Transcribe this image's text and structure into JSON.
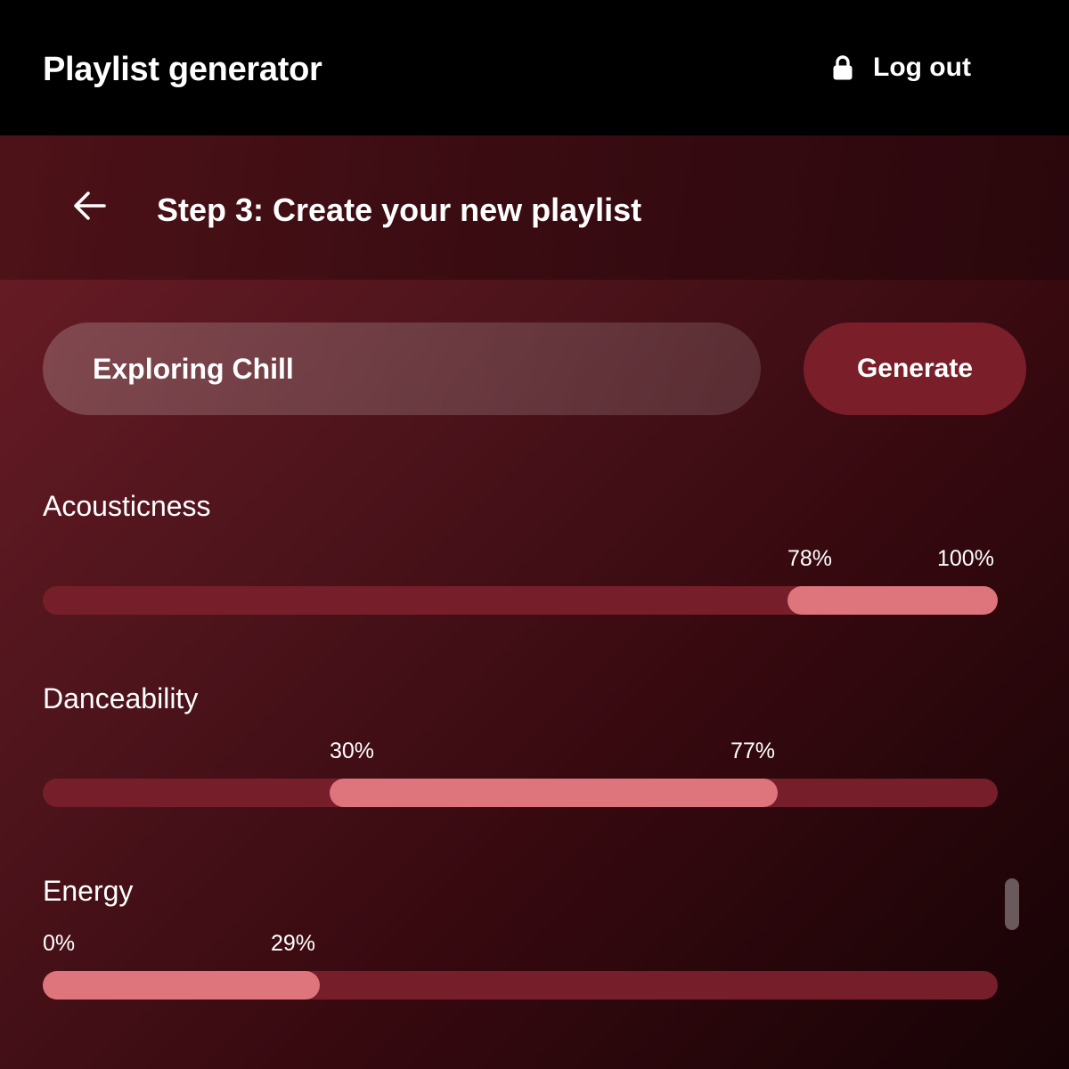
{
  "header": {
    "title": "Playlist generator",
    "logout_label": "Log out",
    "logout_icon": "lock-icon"
  },
  "step": {
    "back_icon": "arrow-left-icon",
    "title": "Step 3: Create your new playlist"
  },
  "form": {
    "playlist_name": "Exploring Chill",
    "generate_label": "Generate"
  },
  "sliders": [
    {
      "name": "acousticness",
      "label": "Acousticness",
      "min": 78,
      "max": 100,
      "min_label": "78%",
      "max_label": "100%"
    },
    {
      "name": "danceability",
      "label": "Danceability",
      "min": 30,
      "max": 77,
      "min_label": "30%",
      "max_label": "77%"
    },
    {
      "name": "energy",
      "label": "Energy",
      "min": 0,
      "max": 29,
      "min_label": "0%",
      "max_label": "29%"
    }
  ],
  "colors": {
    "topbar": "#000000",
    "track": "#761e29",
    "range_fill": "#de747c",
    "generate_button": "#7a1f2a"
  }
}
